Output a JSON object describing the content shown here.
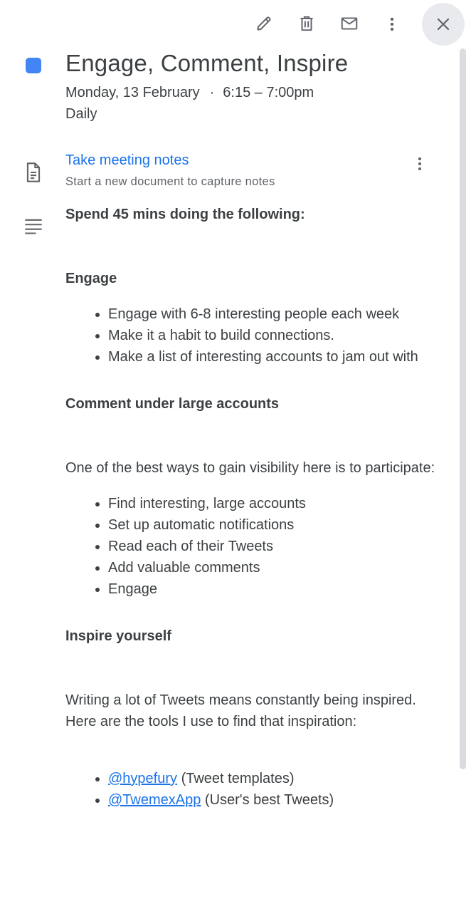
{
  "toolbar": {
    "edit_icon": "pencil-icon",
    "delete_icon": "trash-icon",
    "email_icon": "envelope-icon",
    "more_icon": "more-vert-icon",
    "close_icon": "close-icon"
  },
  "event": {
    "color": "#4285f4",
    "title": "Engage, Comment, Inspire",
    "date": "Monday, 13 February",
    "separator": "·",
    "time": "6:15 – 7:00pm",
    "recurrence": "Daily"
  },
  "meeting_notes": {
    "link_label": "Take meeting notes",
    "subtitle": "Start a new document to capture notes"
  },
  "description": {
    "intro": "Spend 45 mins doing the following:",
    "section1": {
      "heading": "Engage",
      "items": [
        "Engage with 6-8 interesting people each week",
        "Make it a habit to build connections.",
        "Make a list of interesting accounts to jam out with"
      ]
    },
    "section2": {
      "heading": "Comment under large accounts",
      "text": "One of the best ways to gain visibility here is to participate:",
      "items": [
        "Find interesting, large accounts",
        "Set up automatic notifications",
        "Read each of their Tweets",
        "Add valuable comments",
        "Engage"
      ]
    },
    "section3": {
      "heading": "Inspire yourself",
      "text": "Writing a lot of Tweets means constantly being inspired. Here are the tools I use to find that inspiration:",
      "links": [
        {
          "handle": "@hypefury",
          "note": " (Tweet templates)"
        },
        {
          "handle": "@TwemexApp",
          "note": " (User's best Tweets)"
        }
      ]
    }
  }
}
